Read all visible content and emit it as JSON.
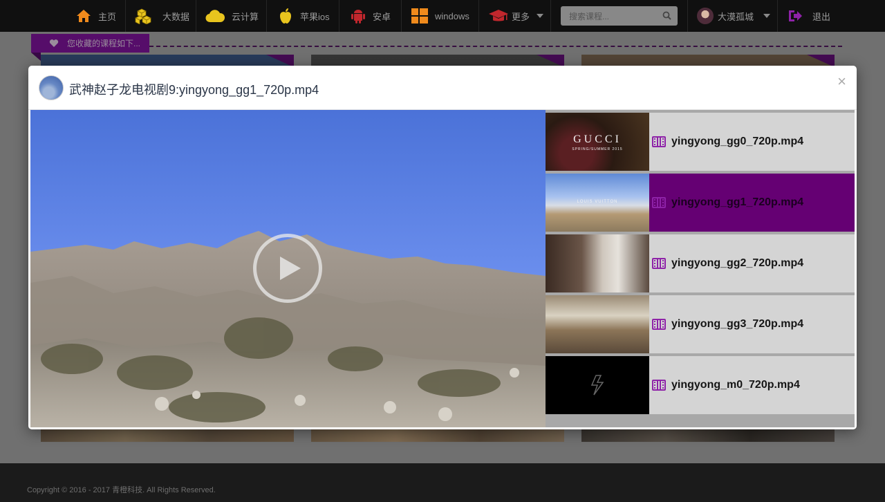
{
  "nav": {
    "items": [
      {
        "label": "主页",
        "icon": "home-icon"
      },
      {
        "label": "大数据",
        "icon": "cubes-icon"
      },
      {
        "label": "云计算",
        "icon": "cloud-icon"
      },
      {
        "label": "苹果ios",
        "icon": "apple-icon"
      },
      {
        "label": "安卓",
        "icon": "android-icon"
      },
      {
        "label": "windows",
        "icon": "windows-icon"
      },
      {
        "label": "更多",
        "icon": "graduation-cap-icon"
      }
    ],
    "search_placeholder": "搜索课程...",
    "user_name": "大漠孤城",
    "logout_label": "退出"
  },
  "favorites": {
    "ribbon_label": "您收藏的课程如下..."
  },
  "modal": {
    "title": "武神赵子龙电视剧9:yingyong_gg1_720p.mp4",
    "close_label": "×",
    "playlist": [
      {
        "label": "yingyong_gg0_720p.mp4",
        "thumb_text": "GUCCI",
        "thumb_sub": "SPRING/SUMMER 2015",
        "active": false
      },
      {
        "label": "yingyong_gg1_720p.mp4",
        "thumb_text": "LOUIS VUITTON",
        "thumb_sub": "",
        "active": true
      },
      {
        "label": "yingyong_gg2_720p.mp4",
        "thumb_text": "",
        "thumb_sub": "",
        "active": false
      },
      {
        "label": "yingyong_gg3_720p.mp4",
        "thumb_text": "",
        "thumb_sub": "",
        "active": false
      },
      {
        "label": "yingyong_m0_720p.mp4",
        "thumb_text": "",
        "thumb_sub": "",
        "active": false
      }
    ]
  },
  "footer": {
    "copyright": "Copyright © 2016 - 2017 青橙科技. All Rights Reserved."
  },
  "colors": {
    "accent_purple": "#650073",
    "nav_bg": "#101010",
    "icon_orange": "#f08a1c",
    "icon_yellow": "#e8c41e",
    "icon_red": "#c1272d"
  }
}
